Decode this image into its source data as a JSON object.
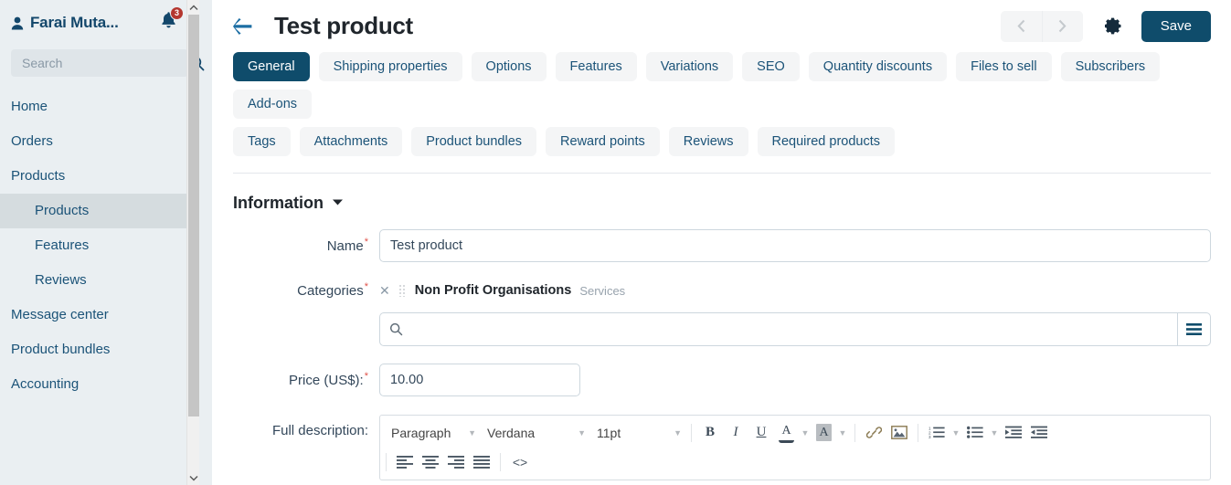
{
  "sidebar": {
    "user_name": "Farai Muta...",
    "user_icon": "person-icon",
    "bell_icon": "bell-icon",
    "notification_count": "3",
    "search_placeholder": "Search",
    "search_value": "",
    "search_icon": "search-icon",
    "items": [
      {
        "label": "Home",
        "level": "top",
        "active": false
      },
      {
        "label": "Orders",
        "level": "top",
        "active": false
      },
      {
        "label": "Products",
        "level": "top",
        "active": false
      },
      {
        "label": "Products",
        "level": "sub",
        "active": true
      },
      {
        "label": "Features",
        "level": "sub",
        "active": false
      },
      {
        "label": "Reviews",
        "level": "sub",
        "active": false
      },
      {
        "label": "Message center",
        "level": "top",
        "active": false
      },
      {
        "label": "Product bundles",
        "level": "top",
        "active": false
      },
      {
        "label": "Accounting",
        "level": "top",
        "active": false
      }
    ]
  },
  "header": {
    "back_icon": "arrow-left-icon",
    "title": "Test product",
    "prev_icon": "chevron-left-icon",
    "next_icon": "chevron-right-icon",
    "gear_icon": "gear-icon",
    "save_label": "Save"
  },
  "tabs": {
    "row1": [
      {
        "label": "General",
        "active": true
      },
      {
        "label": "Shipping properties",
        "active": false
      },
      {
        "label": "Options",
        "active": false
      },
      {
        "label": "Features",
        "active": false
      },
      {
        "label": "Variations",
        "active": false
      },
      {
        "label": "SEO",
        "active": false
      },
      {
        "label": "Quantity discounts",
        "active": false
      },
      {
        "label": "Files to sell",
        "active": false
      },
      {
        "label": "Subscribers",
        "active": false
      },
      {
        "label": "Add-ons",
        "active": false
      }
    ],
    "row2": [
      {
        "label": "Tags",
        "active": false
      },
      {
        "label": "Attachments",
        "active": false
      },
      {
        "label": "Product bundles",
        "active": false
      },
      {
        "label": "Reward points",
        "active": false
      },
      {
        "label": "Reviews",
        "active": false
      },
      {
        "label": "Required products",
        "active": false
      }
    ]
  },
  "section": {
    "title": "Information",
    "collapse_icon": "caret-down-icon"
  },
  "form": {
    "name": {
      "label": "Name",
      "required": "*",
      "value": "Test product",
      "placeholder": ""
    },
    "categories": {
      "label": "Categories",
      "required": "*",
      "chip_remove_icon": "close-icon",
      "chip_drag_icon": "drag-handle-icon",
      "chip_name": "Non Profit Organisations",
      "chip_parent": "Services",
      "search_placeholder": "",
      "search_value": "",
      "search_icon": "search-icon",
      "list_button_icon": "list-icon"
    },
    "price": {
      "label": "Price (US$):",
      "required": "*",
      "value": "10.00",
      "placeholder": ""
    },
    "full_description": {
      "label": "Full description:"
    }
  },
  "editor": {
    "block_format": "Paragraph",
    "font_family": "Verdana",
    "font_size": "11pt",
    "dropdown_icon": "chevron-down-icon",
    "buttons": [
      {
        "name": "bold-icon",
        "glyph": "B"
      },
      {
        "name": "italic-icon",
        "glyph": "I"
      },
      {
        "name": "underline-icon",
        "glyph": "U"
      },
      {
        "name": "text-color-icon",
        "glyph": "A"
      },
      {
        "name": "background-color-icon",
        "glyph": "A"
      },
      {
        "name": "link-icon",
        "glyph": ""
      },
      {
        "name": "image-icon",
        "glyph": ""
      },
      {
        "name": "numbered-list-icon",
        "glyph": ""
      },
      {
        "name": "bullet-list-icon",
        "glyph": ""
      },
      {
        "name": "indent-icon",
        "glyph": ""
      },
      {
        "name": "outdent-icon",
        "glyph": ""
      },
      {
        "name": "align-left-icon",
        "glyph": ""
      },
      {
        "name": "align-center-icon",
        "glyph": ""
      },
      {
        "name": "align-right-icon",
        "glyph": ""
      },
      {
        "name": "align-justify-icon",
        "glyph": ""
      },
      {
        "name": "source-code-icon",
        "glyph": "<>"
      }
    ],
    "source_code_glyph": "<>"
  },
  "colors": {
    "brand_dark": "#0f4c6b",
    "sidebar_bg": "#eaeff2",
    "link_blue": "#1b5378",
    "badge_red": "#b4362f",
    "required_red": "#e0524a"
  }
}
